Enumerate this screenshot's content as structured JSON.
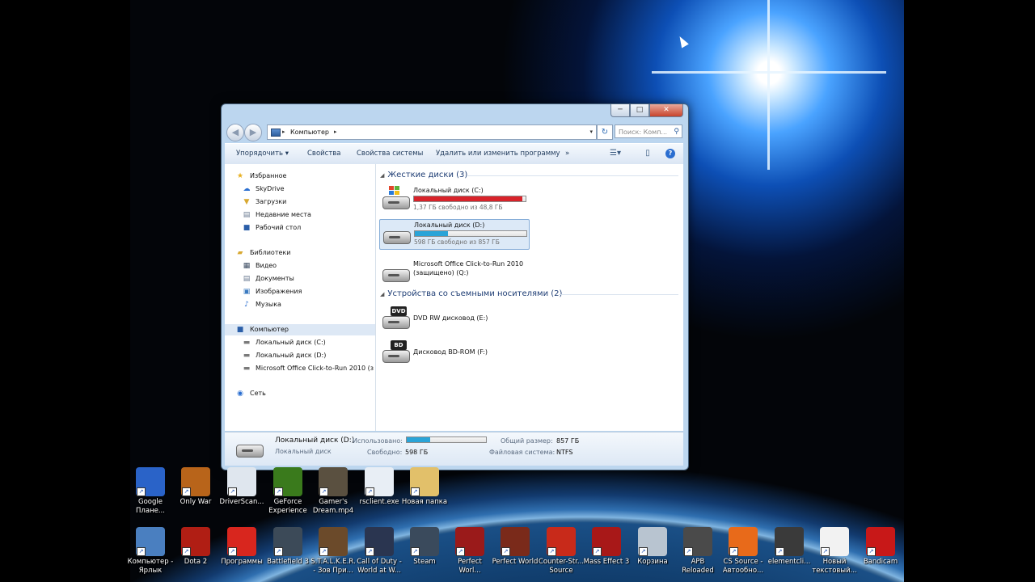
{
  "window": {
    "caption_buttons": [
      "─",
      "□",
      "✕"
    ],
    "breadcrumb": "Компьютер",
    "search_placeholder": "Поиск: Комп...",
    "nav_back": "◀",
    "nav_forward": "▶",
    "refresh": "↻"
  },
  "toolbar": {
    "organize": "Упорядочить ▾",
    "properties": "Свойства",
    "system_properties": "Свойства системы",
    "uninstall": "Удалить или изменить программу",
    "more": "»"
  },
  "nav": {
    "favorites": "Избранное",
    "skydrive": "SkyDrive",
    "downloads": "Загрузки",
    "recent": "Недавние места",
    "desktop": "Рабочий стол",
    "libraries": "Библиотеки",
    "video": "Видео",
    "documents": "Документы",
    "pictures": "Изображения",
    "music": "Музыка",
    "computer": "Компьютер",
    "disk_c": "Локальный диск (C:)",
    "disk_d": "Локальный диск (D:)",
    "office": "Microsoft Office Click-to-Run 2010 (з",
    "network": "Сеть"
  },
  "content": {
    "hdd_group": "Жесткие диски (3)",
    "removable_group": "Устройства со съемными носителями (2)",
    "drives": [
      {
        "name": "Локальный диск (C:)",
        "free": "1,37 ГБ свободно из 48,8 ГБ",
        "used_fraction": 0.97,
        "bar_color": "#d8232a"
      },
      {
        "name": "Локальный диск (D:)",
        "free": "598 ГБ свободно из 857 ГБ",
        "used_fraction": 0.3,
        "bar_color": "#2aa4d8"
      }
    ],
    "office_line1": "Microsoft Office Click-to-Run 2010",
    "office_line2": "(защищено) (Q:)",
    "dvd_name": "DVD RW дисковод (E:)",
    "dvd_label": "DVD",
    "bd_name": "Дисковод BD-ROM (F:)",
    "bd_label": "BD"
  },
  "details": {
    "title": "Локальный диск (D:)",
    "subtitle": "Локальный диск",
    "used_label": "Использовано:",
    "used_fraction": 0.3,
    "free_label": "Свободно:",
    "free_value": "598 ГБ",
    "total_label": "Общий размер:",
    "total_value": "857 ГБ",
    "fs_label": "Файловая система:",
    "fs_value": "NTFS"
  },
  "desktop_icons_row1": [
    {
      "label": "Google Плане...",
      "color": "#2a63c8"
    },
    {
      "label": "Only War",
      "color": "#b8641a"
    },
    {
      "label": "DriverScan...",
      "color": "#dfe6ee"
    },
    {
      "label": "GeForce Experience",
      "color": "#3a7a1c"
    },
    {
      "label": "Gamer's Dream.mp4",
      "color": "#5a5040"
    },
    {
      "label": "rsclient.exe",
      "color": "#e8eef5"
    },
    {
      "label": "Новая папка",
      "color": "#e2c06a"
    }
  ],
  "desktop_icons_row2": [
    {
      "label": "Компьютер - Ярлык",
      "color": "#4a7fc0"
    },
    {
      "label": "Dota 2",
      "color": "#b01e14"
    },
    {
      "label": "Программы",
      "color": "#d8261e"
    },
    {
      "label": "Battlefield 3",
      "color": "#3c4a58"
    },
    {
      "label": "S.T.A.L.K.E.R. - Зов При...",
      "color": "#6b4a2a"
    },
    {
      "label": "Call of Duty - World at W...",
      "color": "#2a3550"
    },
    {
      "label": "Steam",
      "color": "#3a4a5c"
    },
    {
      "label": "Perfect Worl...",
      "color": "#9a1a1a"
    },
    {
      "label": "Perfect World",
      "color": "#7a2a1a"
    },
    {
      "label": "Counter-Str... Source",
      "color": "#c82a1a"
    },
    {
      "label": "Mass Effect 3",
      "color": "#a81818"
    },
    {
      "label": "Корзина",
      "color": "#b8c4d0"
    },
    {
      "label": "APB Reloaded",
      "color": "#4a4a4a"
    },
    {
      "label": "CS Source - Автообно...",
      "color": "#e86a1a"
    },
    {
      "label": "elementcli...",
      "color": "#3a3a3a"
    },
    {
      "label": "Новый текстовый...",
      "color": "#f2f2f2"
    },
    {
      "label": "Bandicam",
      "color": "#c81818"
    }
  ]
}
